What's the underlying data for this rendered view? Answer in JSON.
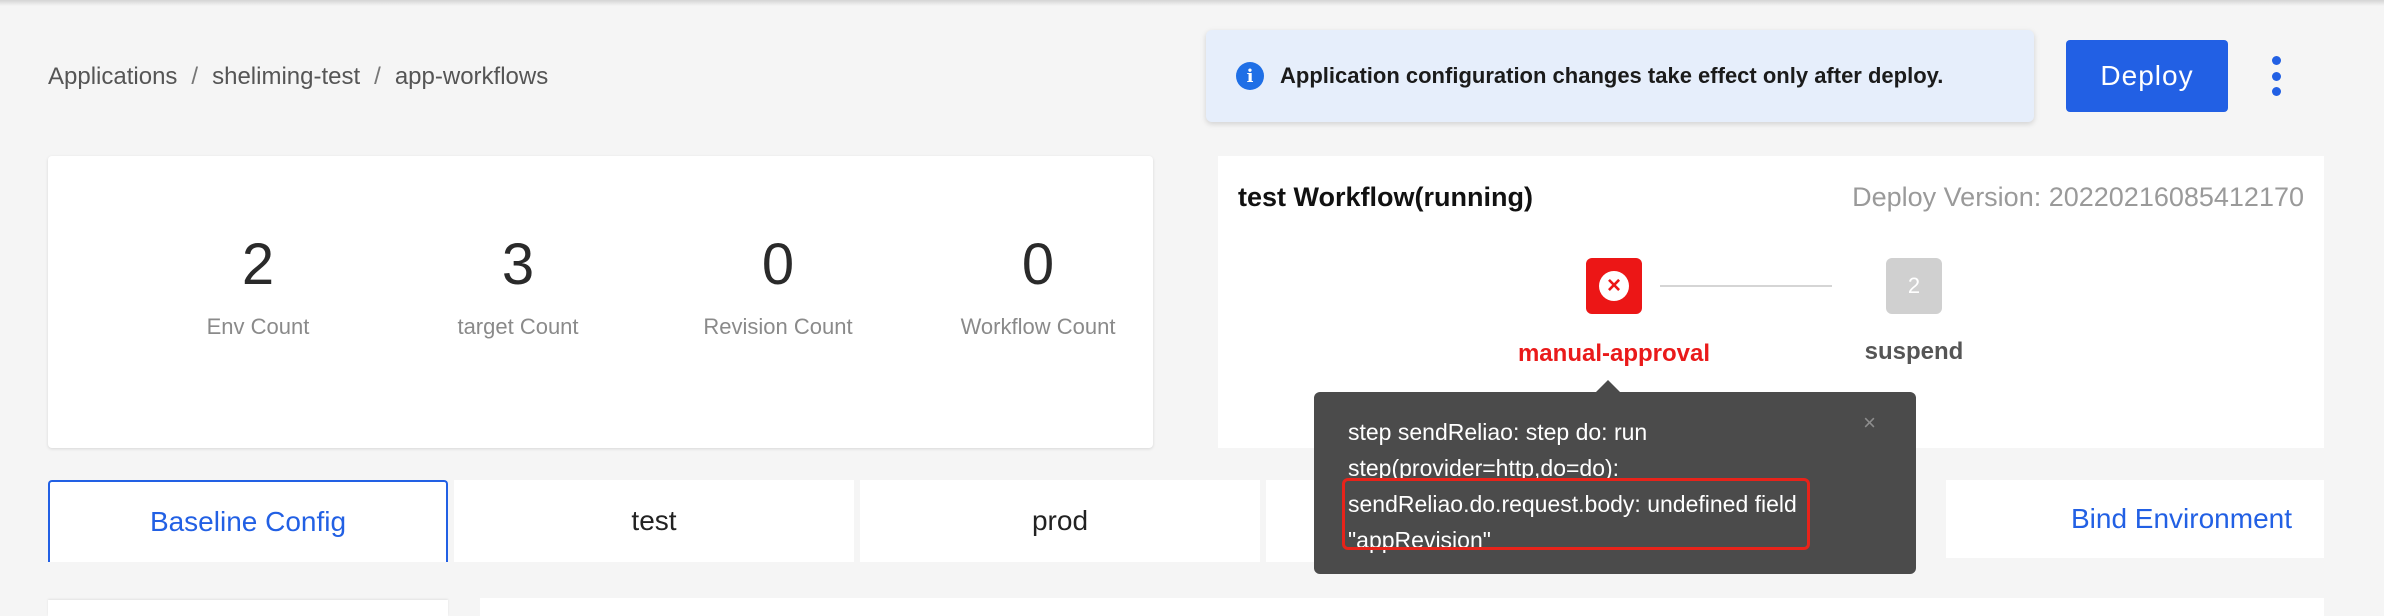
{
  "breadcrumb": {
    "items": [
      "Applications",
      "sheliming-test",
      "app-workflows"
    ],
    "separator": "/"
  },
  "notice": {
    "icon": "info-icon",
    "text": "Application configuration changes take effect only after deploy."
  },
  "header": {
    "deploy_label": "Deploy",
    "more_icon": "vertical-ellipsis-icon"
  },
  "stats": [
    {
      "value": "2",
      "label": "Env Count"
    },
    {
      "value": "3",
      "label": "target Count"
    },
    {
      "value": "0",
      "label": "Revision Count"
    },
    {
      "value": "0",
      "label": "Workflow Count"
    }
  ],
  "workflow": {
    "title": "test Workflow(running)",
    "version": "Deploy Version: 20220216085412170",
    "steps": [
      {
        "name": "manual-approval",
        "status": "failed",
        "icon": "close-circle-icon"
      },
      {
        "name": "suspend",
        "index": "2",
        "status": "pending"
      }
    ]
  },
  "tooltip": {
    "text": "step sendReliao: step do: run step(provider=http,do=do): sendReliao.do.request.body: undefined field \"appRevision\"",
    "close_symbol": "×"
  },
  "tabs": [
    {
      "label": "Baseline Config",
      "active": true
    },
    {
      "label": "test",
      "active": false
    },
    {
      "label": "prod",
      "active": false
    },
    {
      "label": "",
      "active": false
    }
  ],
  "bind_environment_label": "Bind Environment",
  "colors": {
    "accent": "#2260e4",
    "error": "#ec1616",
    "tooltip_bg": "#4b4b4b",
    "highlight": "#e8231a"
  }
}
